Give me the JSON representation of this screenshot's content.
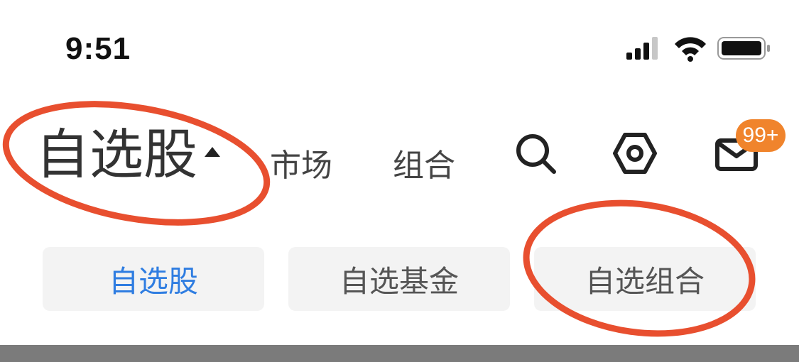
{
  "status_bar": {
    "time": "9:51",
    "icons": [
      "signal-icon",
      "wifi-icon",
      "battery-icon"
    ]
  },
  "header": {
    "tabs": [
      {
        "label": "自选股",
        "active": true
      },
      {
        "label": "市场"
      },
      {
        "label": "组合"
      }
    ],
    "actions": [
      "search-icon",
      "settings-icon",
      "mail-icon"
    ],
    "mail_badge": "99+"
  },
  "segments": [
    {
      "label": "自选股",
      "active": true
    },
    {
      "label": "自选基金"
    },
    {
      "label": "自选组合"
    }
  ],
  "colors": {
    "accent": "#2f7de1",
    "badge": "#f0842c",
    "annotation": "#e84f2f"
  }
}
